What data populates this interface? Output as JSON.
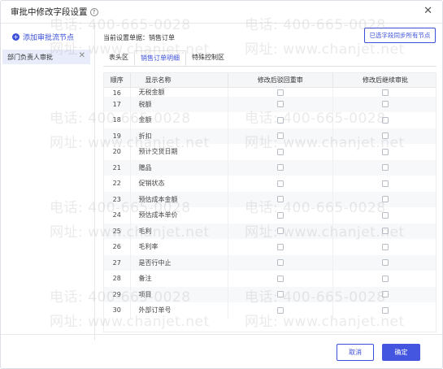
{
  "dialog": {
    "title": "审批中修改字段设置",
    "help_icon": "?",
    "close_icon": "✕"
  },
  "sidebar": {
    "add_node_label": "添加审批流节点",
    "nodes": [
      {
        "label": "部门负责人审批",
        "remove_icon": "✕"
      }
    ]
  },
  "main": {
    "current_doc_label": "当前设置单据：销售订单",
    "sync_button_label": "已选字段同步所有节点",
    "tabs": [
      {
        "label": "表头区",
        "active": false
      },
      {
        "label": "销售订单明细",
        "active": true
      },
      {
        "label": "特殊控制区",
        "active": false
      }
    ],
    "table": {
      "headers": [
        "顺序",
        "显示名称",
        "修改后驳回重审",
        "修改后继续审批"
      ],
      "rows": [
        {
          "seq": "16",
          "name": "无税金额"
        },
        {
          "seq": "17",
          "name": "税额"
        },
        {
          "seq": "18",
          "name": "金额"
        },
        {
          "seq": "19",
          "name": "折扣"
        },
        {
          "seq": "20",
          "name": "预计交货日期"
        },
        {
          "seq": "21",
          "name": "赠品"
        },
        {
          "seq": "22",
          "name": "促销状态"
        },
        {
          "seq": "23",
          "name": "预估成本金额"
        },
        {
          "seq": "24",
          "name": "预估成本单价"
        },
        {
          "seq": "25",
          "name": "毛利"
        },
        {
          "seq": "26",
          "name": "毛利率"
        },
        {
          "seq": "27",
          "name": "是否行中止"
        },
        {
          "seq": "28",
          "name": "备注"
        },
        {
          "seq": "29",
          "name": "项目"
        },
        {
          "seq": "30",
          "name": "外部订单号"
        }
      ]
    }
  },
  "footer": {
    "cancel_label": "取消",
    "ok_label": "确定"
  },
  "watermark": {
    "phone": "电话: 400-665-0028",
    "site": "网址: www.chanjet.net"
  },
  "colors": {
    "accent": "#3b4fd8",
    "primary_button": "#4456e0",
    "selected_node_bg": "#e8ecfb"
  }
}
